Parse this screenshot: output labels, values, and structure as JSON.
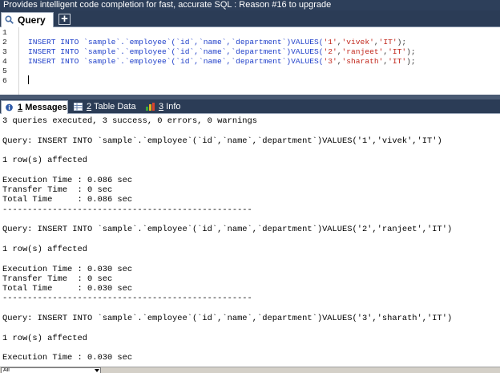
{
  "title_bar": {
    "text": "Provides intelligent code completion for fast, accurate SQL : Reason #16 to upgrade"
  },
  "query_tab": {
    "label": "Query",
    "new_tab_symbol": "+"
  },
  "editor": {
    "line_numbers": [
      "1",
      "2",
      "3",
      "4",
      "5",
      "6"
    ],
    "lines": [
      {
        "pre": "INSERT INTO `sample`.`employee`(`id`,`name`,`department`)",
        "kw": "VALUES(",
        "v1": "'1'",
        "v2": "'vivek'",
        "v3": "'IT'",
        "end": ");"
      },
      {
        "pre": "INSERT INTO `sample`.`employee`(`id`,`name`,`department`)",
        "kw": "VALUES(",
        "v1": "'2'",
        "v2": "'ranjeet'",
        "v3": "'IT'",
        "end": ");"
      },
      {
        "pre": "INSERT INTO `sample`.`employee`(`id`,`name`,`department`)",
        "kw": "VALUES(",
        "v1": "'3'",
        "v2": "'sharath'",
        "v3": "'IT'",
        "end": ");"
      }
    ],
    "comma": ","
  },
  "panel_tabs": [
    {
      "num": "1",
      "label": "Messages"
    },
    {
      "num": "2",
      "label": "Table Data"
    },
    {
      "num": "3",
      "label": "Info"
    }
  ],
  "messages": {
    "lines": [
      "3 queries executed, 3 success, 0 errors, 0 warnings",
      "",
      "Query: INSERT INTO `sample`.`employee`(`id`,`name`,`department`)VALUES('1','vivek','IT')",
      "",
      "1 row(s) affected",
      "",
      "Execution Time : 0.086 sec",
      "Transfer Time  : 0 sec",
      "Total Time     : 0.086 sec",
      "--------------------------------------------------",
      "",
      "Query: INSERT INTO `sample`.`employee`(`id`,`name`,`department`)VALUES('2','ranjeet','IT')",
      "",
      "1 row(s) affected",
      "",
      "Execution Time : 0.030 sec",
      "Transfer Time  : 0 sec",
      "Total Time     : 0.030 sec",
      "--------------------------------------------------",
      "",
      "Query: INSERT INTO `sample`.`employee`(`id`,`name`,`department`)VALUES('3','sharath','IT')",
      "",
      "1 row(s) affected",
      "",
      "Execution Time : 0.030 sec"
    ]
  },
  "status_bar": {
    "select_value": "All"
  },
  "colors": {
    "keyword": "#1f3fc9",
    "string": "#c2291e",
    "chrome": "#2b3c56"
  }
}
